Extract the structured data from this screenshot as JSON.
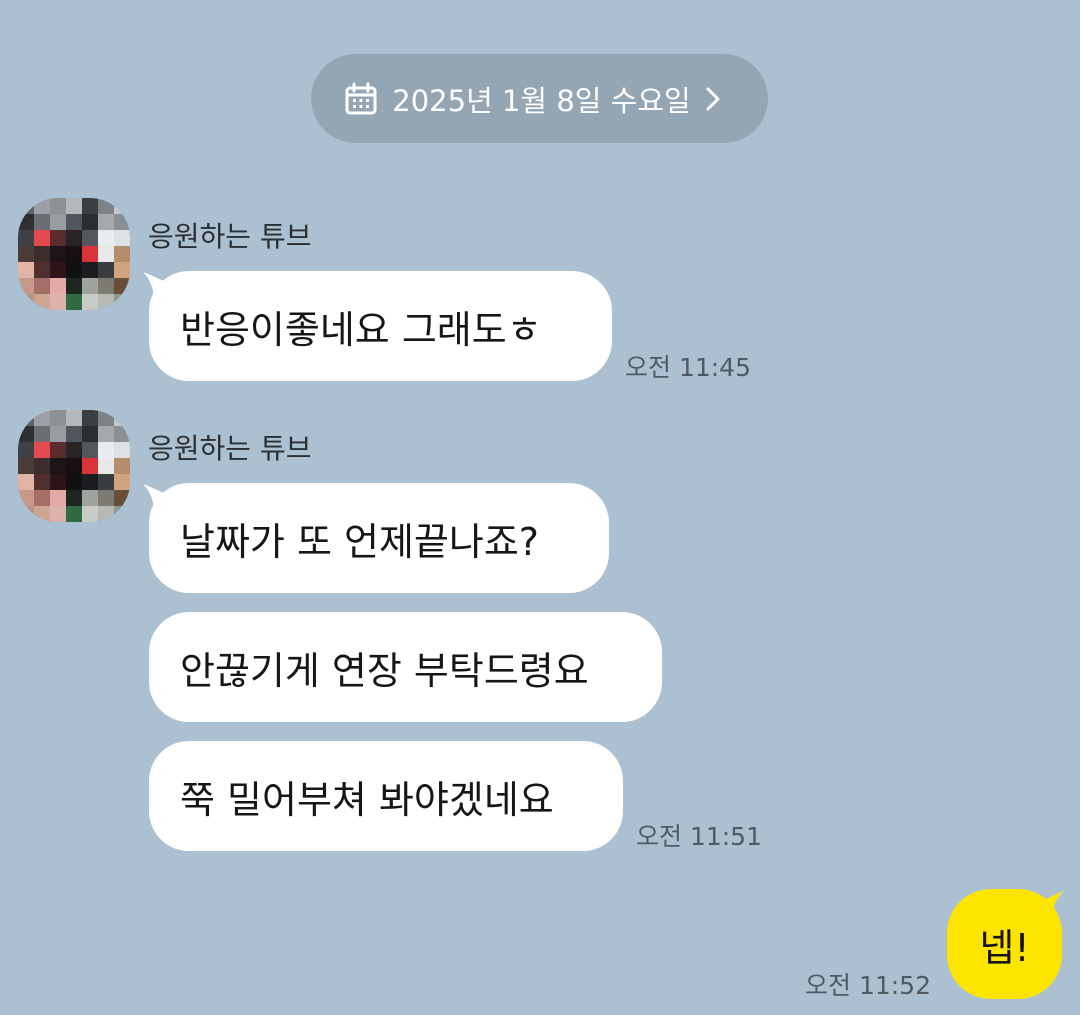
{
  "date_divider": {
    "text": "2025년 1월 8일 수요일",
    "icon": "calendar-icon",
    "chevron": "chevron-right-icon"
  },
  "groups": [
    {
      "sender": "응원하는 튜브",
      "messages": [
        {
          "text": "반응이좋네요 그래도ㅎ"
        }
      ],
      "time": "오전 11:45"
    },
    {
      "sender": "응원하는 튜브",
      "messages": [
        {
          "text": "날짜가 또 언제끝나죠?"
        },
        {
          "text": "안끊기게 연장 부탁드령요"
        },
        {
          "text": "쭉 밀어부쳐 봐야겠네요"
        }
      ],
      "time": "오전 11:51"
    }
  ],
  "my_message": {
    "text": "넵!",
    "time": "오전 11:52"
  },
  "colors": {
    "background": "#abc1d1",
    "date_pill": "#94a6b4",
    "incoming_bubble": "#ffffff",
    "outgoing_bubble": "#fee500",
    "timestamp": "#4f5a63"
  }
}
